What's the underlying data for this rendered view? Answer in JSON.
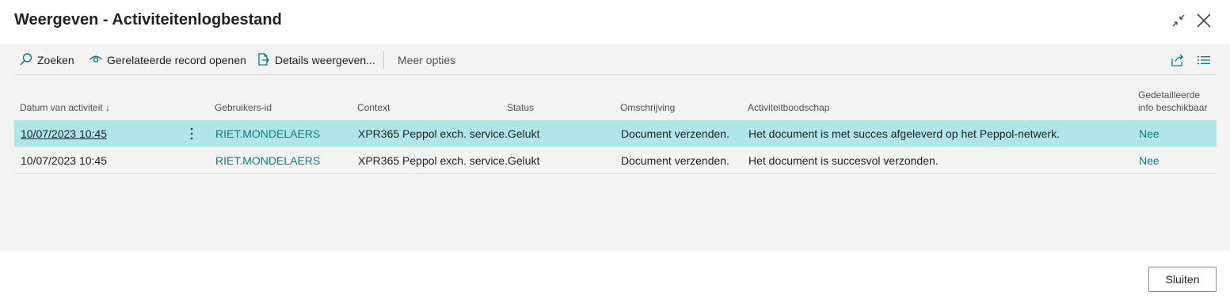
{
  "dialog": {
    "title": "Weergeven - Activiteitenlogbestand",
    "collapse_icon": "collapse-icon",
    "close_icon": "close-icon"
  },
  "actions": {
    "search": {
      "label": "Zoeken",
      "icon": "search-icon"
    },
    "open_related": {
      "label": "Gerelateerde record openen",
      "icon": "eye-icon"
    },
    "show_details": {
      "label": "Details weergeven...",
      "icon": "document-export-icon"
    },
    "more": {
      "label": "Meer opties"
    },
    "share_icon": "share-icon",
    "list_view_icon": "list-view-icon"
  },
  "table": {
    "columns": [
      {
        "label": "Datum van activiteit ↓"
      },
      {
        "label": "Gebruikers-id"
      },
      {
        "label": "Context"
      },
      {
        "label": "Status"
      },
      {
        "label": "Omschrijving"
      },
      {
        "label": "Activiteitboodschap"
      },
      {
        "label": "Gedetailleerde info beschikbaar"
      }
    ],
    "rows": [
      {
        "date": "10/07/2023 10:45",
        "user": "RIET.MONDELAERS",
        "context": "XPR365 Peppol exch. service.",
        "status": "Gelukt",
        "description": "Document verzenden.",
        "message": "Het document is met succes afgeleverd op het Peppol-netwerk.",
        "detail": "Nee",
        "selected": true
      },
      {
        "date": "10/07/2023 10:45",
        "user": "RIET.MONDELAERS",
        "context": "XPR365 Peppol exch. service.",
        "status": "Gelukt",
        "description": "Document verzenden.",
        "message": "Het document is succesvol verzonden.",
        "detail": "Nee",
        "selected": false
      }
    ]
  },
  "footer": {
    "close_label": "Sluiten"
  },
  "colors": {
    "accent": "#0b7d80",
    "selected_row": "#b1e6e9",
    "content_bg": "#f3f3f4"
  }
}
